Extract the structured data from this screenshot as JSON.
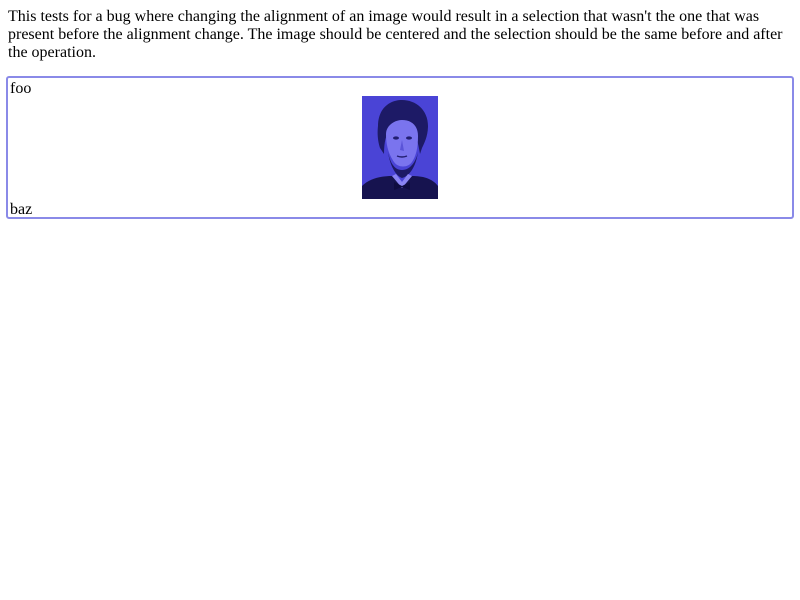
{
  "intro": {
    "text": "This tests for a bug where changing the alignment of an image would result in a selection that wasn't the one that was present before the alignment change. The image should be centered and the selection should be the same before and after the operation."
  },
  "editor": {
    "line1": "foo",
    "line2": "baz",
    "image_icon": "portrait-image",
    "border_color": "#8a8ae8",
    "image_tint": "#4a44d6"
  }
}
